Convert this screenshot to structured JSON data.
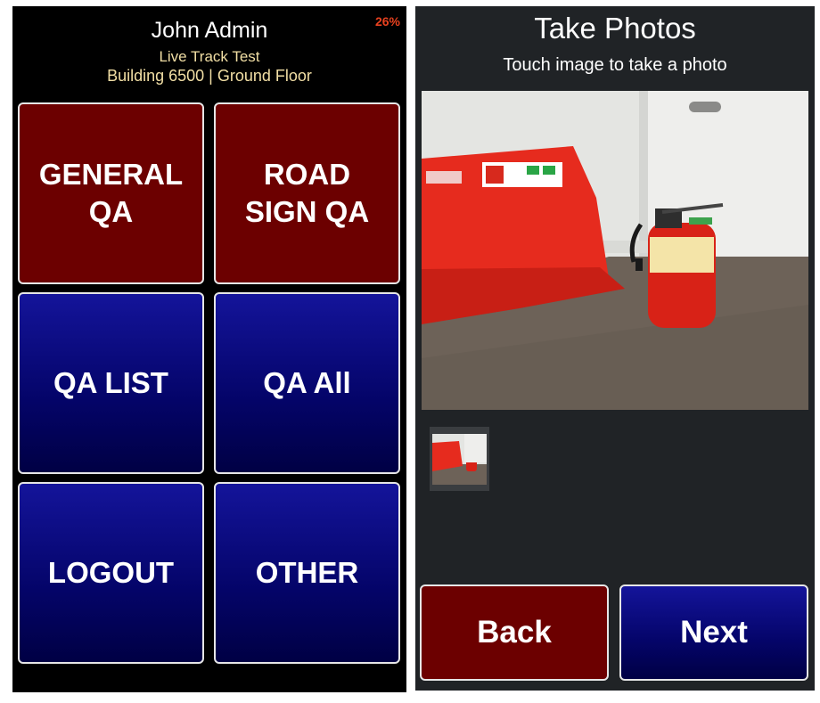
{
  "home_screen": {
    "battery": "26%",
    "user_name": "John Admin",
    "project_name": "Live Track Test",
    "location": "Building 6500 | Ground Floor",
    "tiles": [
      {
        "label": "GENERAL\nQA",
        "color": "#6c0000"
      },
      {
        "label": "ROAD\nSIGN QA",
        "color": "#6c0000"
      },
      {
        "label": "QA LIST",
        "color": "#0a0a80"
      },
      {
        "label": "QA All",
        "color": "#0a0a80"
      },
      {
        "label": "LOGOUT",
        "color": "#0a0a80"
      },
      {
        "label": "OTHER",
        "color": "#0a0a80"
      }
    ]
  },
  "photo_screen": {
    "title": "Take Photos",
    "subtitle": "Touch image to take a photo",
    "photo_icon": "fire-extinguisher-photo",
    "thumbnails": 1,
    "back_label": "Back",
    "next_label": "Next"
  },
  "colors": {
    "red_button": "#6c0000",
    "blue_button": "#0a0a80",
    "battery_text": "#e8411f",
    "info_text": "#f2dfa5"
  }
}
